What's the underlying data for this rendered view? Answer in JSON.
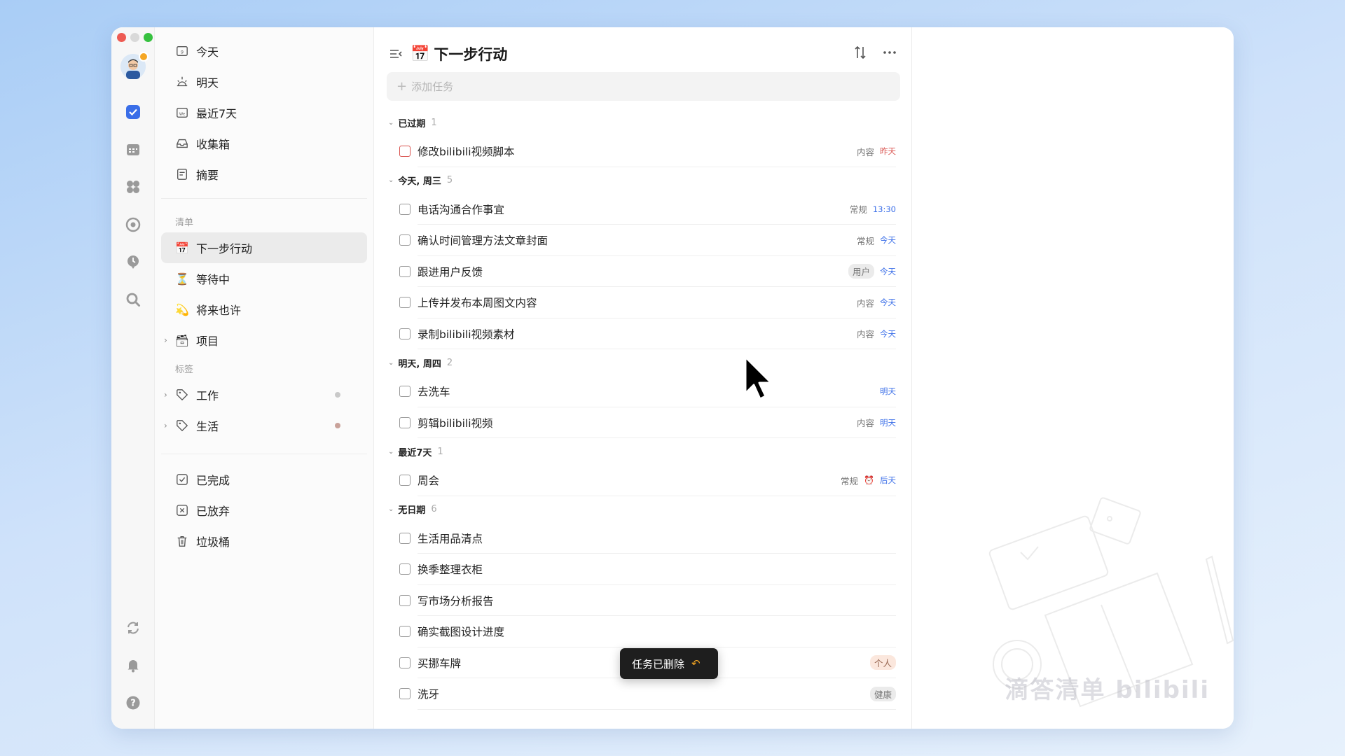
{
  "sidebar": {
    "smart_lists": [
      {
        "label": "今天",
        "icon": "calendar-day-icon"
      },
      {
        "label": "明天",
        "icon": "sunrise-icon"
      },
      {
        "label": "最近7天",
        "icon": "calendar-week-icon"
      },
      {
        "label": "收集箱",
        "icon": "inbox-icon"
      },
      {
        "label": "摘要",
        "icon": "summary-icon"
      }
    ],
    "lists_section": "清单",
    "lists": [
      {
        "label": "下一步行动",
        "emoji": "📅",
        "active": true
      },
      {
        "label": "等待中",
        "emoji": "⏳"
      },
      {
        "label": "将来也许",
        "emoji": "💫"
      },
      {
        "label": "项目",
        "emoji": "🗃"
      }
    ],
    "tags_section": "标签",
    "tags": [
      {
        "label": "工作",
        "dot_color": "#c9c9c9"
      },
      {
        "label": "生活",
        "dot_color": "#c9a29a"
      }
    ],
    "bottom": [
      {
        "label": "已完成",
        "icon": "check-square-icon"
      },
      {
        "label": "已放弃",
        "icon": "x-square-icon"
      },
      {
        "label": "垃圾桶",
        "icon": "trash-icon"
      }
    ]
  },
  "main": {
    "title_emoji": "📅",
    "title": "下一步行动",
    "add_placeholder": "添加任务",
    "groups": [
      {
        "name": "已过期",
        "count": "1",
        "tasks": [
          {
            "title": "修改bilibili视频脚本",
            "tag": "内容",
            "date": "昨天",
            "date_color": "red",
            "overdue": true
          }
        ]
      },
      {
        "name": "今天, 周三",
        "count": "5",
        "tasks": [
          {
            "title": "电话沟通合作事宜",
            "tag": "常规",
            "date": "13:30",
            "date_color": "blue"
          },
          {
            "title": "确认时间管理方法文章封面",
            "tag": "常规",
            "date": "今天",
            "date_color": "blue"
          },
          {
            "title": "跟进用户反馈",
            "tag": "用户",
            "tag_style": "pill",
            "date": "今天",
            "date_color": "blue"
          },
          {
            "title": "上传并发布本周图文内容",
            "tag": "内容",
            "date": "今天",
            "date_color": "blue"
          },
          {
            "title": "录制bilibili视频素材",
            "tag": "内容",
            "date": "今天",
            "date_color": "blue"
          }
        ]
      },
      {
        "name": "明天, 周四",
        "count": "2",
        "tasks": [
          {
            "title": "去洗车",
            "tag": "",
            "date": "明天",
            "date_color": "blue"
          },
          {
            "title": "剪辑bilibili视频",
            "tag": "内容",
            "date": "明天",
            "date_color": "blue"
          }
        ]
      },
      {
        "name": "最近7天",
        "count": "1",
        "tasks": [
          {
            "title": "周会",
            "tag": "常规",
            "alarm": true,
            "date": "后天",
            "date_color": "blue"
          }
        ]
      },
      {
        "name": "无日期",
        "count": "6",
        "tasks": [
          {
            "title": "生活用品清点",
            "tag": "",
            "date": ""
          },
          {
            "title": "换季整理衣柜",
            "tag": "",
            "date": ""
          },
          {
            "title": "写市场分析报告",
            "tag": "",
            "date": ""
          },
          {
            "title": "确实截图设计进度",
            "tag": "",
            "date": ""
          },
          {
            "title": "买挪车牌",
            "tag": "个人",
            "tag_style": "pill-orange",
            "date": ""
          },
          {
            "title": "洗牙",
            "tag": "健康",
            "tag_style": "pill",
            "date": ""
          }
        ]
      }
    ]
  },
  "toast": {
    "message": "任务已删除",
    "undo_icon": "undo-icon"
  },
  "watermark": {
    "text": "滴答清单 bilibili"
  }
}
